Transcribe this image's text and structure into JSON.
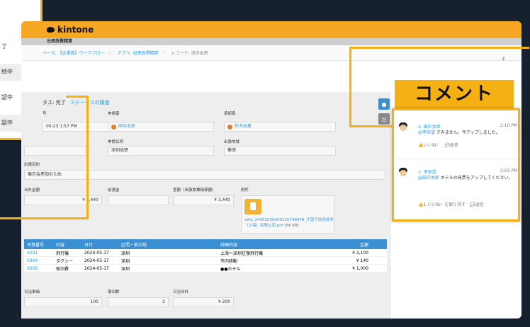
{
  "app": {
    "logo": "kintone",
    "app_title": "出張旅費精算"
  },
  "breadcrumb": {
    "space": "ペース: 【企業様】ワークフロー",
    "app": "アプリ: 出張旅費精算",
    "record": "レコード: 深圳出張"
  },
  "record": {
    "status_label": "タス: 完了",
    "status_history": "ステータスの履歴",
    "fields": {
      "date_label": "号",
      "date_value": "05-23 1:57 PM",
      "applicant_label": "申請者",
      "applicant_value": "田中太郎",
      "approver_label": "承認者",
      "approver_value": "鈴木由恵",
      "name_label": "申請名称",
      "name_value": "深圳出張",
      "region_label": "出張地域",
      "region_value": "華南",
      "purpose_label": "出張目的",
      "purpose_value": "展示会参加のため",
      "total_label": "合計金額",
      "total_value": "¥ 3,440",
      "advance_label": "前渡金",
      "advance_value": "",
      "diff_label": "差額（出張旅費精算額）",
      "diff_value": "¥ 3,440",
      "attach_label": "附件",
      "attach_file": "dzfp_24952000000135748478_才望子信息技术（上海）有限公司.pdf",
      "attach_size": "(56 KB)",
      "daily_rate_label": "日当単価",
      "daily_rate_value": "100",
      "nights_label": "宿泊数",
      "nights_value": "2",
      "daily_total_label": "日当合計",
      "daily_total_value": "¥ 200"
    },
    "table": {
      "headers": [
        "予算番号",
        "内容",
        "日付",
        "区間・宿泊地",
        "詳細内容",
        "金額"
      ],
      "rows": [
        [
          "S001",
          "飛行機",
          "2024-05-17",
          "深圳",
          "上海～深圳往復飛行機",
          "¥ 2,100"
        ],
        [
          "S004",
          "タクシー",
          "2024-05-17",
          "深圳",
          "市内移動",
          "¥ 140"
        ],
        [
          "S005",
          "宿泊費",
          "2024-05-17",
          "深圳",
          "●●ホテル",
          "¥ 1,000"
        ]
      ]
    }
  },
  "comments": {
    "callout": "コメント",
    "items": [
      {
        "author": "2: 田中太郎",
        "time": "2:10 PM",
        "mention": "@李匡望",
        "text": " すみません。今アップしました。",
        "like": "いいね！",
        "reply": "返信"
      },
      {
        "author": "1: 李匡望",
        "time": "2:03 PM",
        "mention": "@田中太郎",
        "text": " ホテルの発票をアップしてください。",
        "like": "1 いいね！を取り消す",
        "reply": "返信"
      }
    ]
  },
  "popup": {
    "items": [
      "了",
      "続中",
      "認中",
      "認中"
    ]
  },
  "colors": {
    "accent": "#f5a623",
    "highlight": "#f5b014",
    "link": "#3498db",
    "table_header": "#3b8fd3"
  }
}
